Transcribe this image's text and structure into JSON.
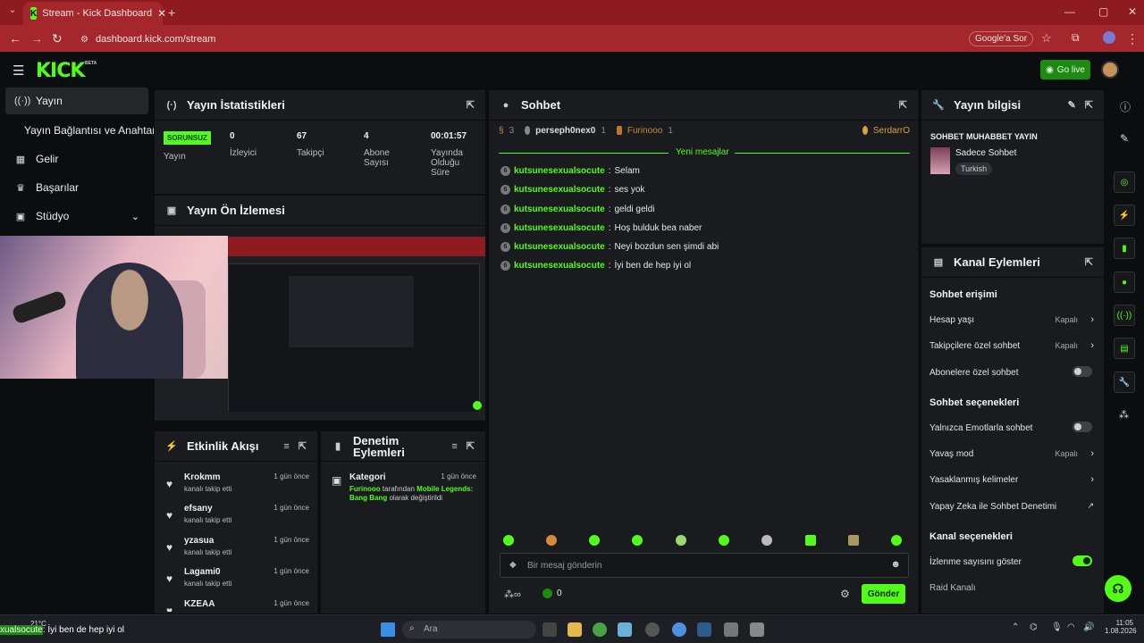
{
  "browser": {
    "tab_title": "Stream - Kick Dashboard",
    "url": "dashboard.kick.com/stream",
    "google_sor": "Google'a Sor"
  },
  "header": {
    "logo": "KICK",
    "beta": "BETA",
    "go_live": "Go live"
  },
  "sidebar": {
    "items": [
      {
        "label": "Yayın",
        "icon": "broadcast-icon"
      },
      {
        "label": "Gelir",
        "icon": "chart-icon"
      },
      {
        "label": "Başarılar",
        "icon": "trophy-icon"
      },
      {
        "label": "Stüdyo",
        "icon": "studio-icon"
      }
    ],
    "sub": "Yayın Bağlantısı ve Anahtarı"
  },
  "stats": {
    "title": "Yayın İstatistikleri",
    "status_badge": "SORUNSUZ",
    "status_label": "Yayın",
    "viewers": "0",
    "viewers_label": "İzleyici",
    "followers": "67",
    "followers_label": "Takipçi",
    "subs": "4",
    "subs_label": "Abone Sayısı",
    "duration": "00:01:57",
    "duration_label": "Yayında Olduğu Süre"
  },
  "preview": {
    "title": "Yayın Ön İzlemesi"
  },
  "events": {
    "title": "Etkinlik Akışı",
    "rows": [
      {
        "name": "Krokmm",
        "sub": "kanalı takip etti",
        "time": "1 gün önce"
      },
      {
        "name": "efsany",
        "sub": "kanalı takip etti",
        "time": "1 gün önce"
      },
      {
        "name": "yzasua",
        "sub": "kanalı takip etti",
        "time": "1 gün önce"
      },
      {
        "name": "Lagami0",
        "sub": "kanalı takip etti",
        "time": "1 gün önce"
      },
      {
        "name": "KZEAA",
        "sub": "",
        "time": "1 gün önce"
      }
    ]
  },
  "moderation": {
    "title": "Denetim Eylemleri",
    "item_title": "Kategori",
    "item_time": "1 gün önce",
    "user": "Furinooo",
    "text1": "tarafından",
    "game": "Mobile Legends: Bang Bang",
    "text2": "olarak değiştirildi"
  },
  "chat": {
    "title": "Sohbet",
    "top_users": [
      {
        "name": "3",
        "count": ""
      },
      {
        "name": "perseph0nex0",
        "count": "1"
      },
      {
        "name": "Furinooo",
        "count": "1"
      },
      {
        "name": "SerdarrO",
        "count": ""
      }
    ],
    "new_messages": "Yeni mesajlar",
    "messages": [
      {
        "user": "kutsunesexualsocute",
        "text": "Selam"
      },
      {
        "user": "kutsunesexualsocute",
        "text": "ses yok"
      },
      {
        "user": "kutsunesexualsocute",
        "text": "geldi geldi"
      },
      {
        "user": "kutsunesexualsocute",
        "text": "Hoş bulduk bea naber"
      },
      {
        "user": "kutsunesexualsocute",
        "text": "Neyi bozdun sen şimdi abi"
      },
      {
        "user": "kutsunesexualsocute",
        "text": "İyi ben de hep iyi ol"
      }
    ],
    "input_placeholder": "Bir mesaj gönderin",
    "points": "0",
    "send": "Gönder"
  },
  "stream_info": {
    "title": "Yayın bilgisi",
    "stream_title": "SOHBET MUHABBET YAYIN",
    "category": "Sadece Sohbet",
    "language": "Turkish"
  },
  "channel_actions": {
    "title": "Kanal Eylemleri",
    "sec1": "Sohbet erişimi",
    "account_age": "Hesap yaşı",
    "account_age_val": "Kapalı",
    "followers_only": "Takipçilere özel sohbet",
    "followers_only_val": "Kapalı",
    "subs_only": "Abonelere özel sohbet",
    "sec2": "Sohbet seçenekleri",
    "emote_only": "Yalnızca Emotlarla sohbet",
    "slow_mode": "Yavaş mod",
    "slow_mode_val": "Kapalı",
    "banned_words": "Yasaklanmış kelimeler",
    "ai_mod": "Yapay Zeka ile Sohbet Denetimi",
    "sec3": "Kanal seçenekleri",
    "show_viewers": "İzlenme sayısını göster",
    "raid": "Raid Kanalı"
  },
  "taskbar": {
    "weather": "21°C",
    "search": "Ara",
    "time": "11:05",
    "date": "1.08.2026",
    "ticker_user": "xualsocute",
    "ticker_text": "İyi ben de hep iyi ol"
  },
  "colors": {
    "accent": "#53fc18",
    "browser": "#a4272b",
    "panel": "#191b1f"
  }
}
